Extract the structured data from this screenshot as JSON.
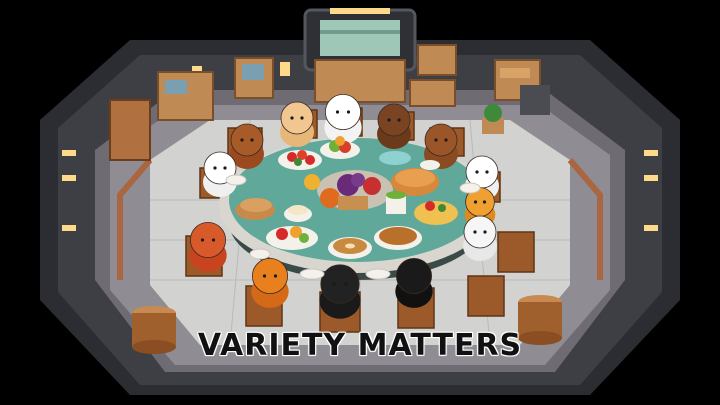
{
  "scene": {
    "caption": "VARIETY MATTERS",
    "characters": [
      {
        "name": "character-seat-1",
        "color": "#9a4a1e",
        "head": "#a85a28"
      },
      {
        "name": "character-seat-2",
        "color": "#e7b77a",
        "head": "#f2c690"
      },
      {
        "name": "character-seat-3",
        "color": "#f3f3f3",
        "head": "#ffffff"
      },
      {
        "name": "character-seat-4",
        "color": "#6b3a1a",
        "head": "#7a4422"
      },
      {
        "name": "character-seat-5",
        "color": "#8a4a22",
        "head": "#9a5628"
      },
      {
        "name": "character-seat-6",
        "color": "#f0f0f0",
        "head": "#ffffff"
      },
      {
        "name": "character-seat-7",
        "color": "#f0f0f0",
        "head": "#ffffff"
      },
      {
        "name": "character-seat-8",
        "color": "#e08a1e",
        "head": "#f0a030"
      },
      {
        "name": "character-seat-9",
        "color": "#e8e8e8",
        "head": "#f6f6f6"
      },
      {
        "name": "character-seat-10",
        "color": "#c8441e",
        "head": "#d85a2a"
      },
      {
        "name": "character-seat-11",
        "color": "#d46a18",
        "head": "#e8801e"
      },
      {
        "name": "character-seat-12",
        "color": "#1a1a1a",
        "head": "#222222"
      },
      {
        "name": "character-seat-13",
        "color": "#111111",
        "head": "#1a1a1a"
      }
    ],
    "colors": {
      "floor": "#8f8c93",
      "floor_inner": "#d2d3d0",
      "wall": "#3d3f45",
      "table": "#5fa89a",
      "table_edge": "#d9d6cf",
      "wood": "#9c5a2a"
    }
  }
}
